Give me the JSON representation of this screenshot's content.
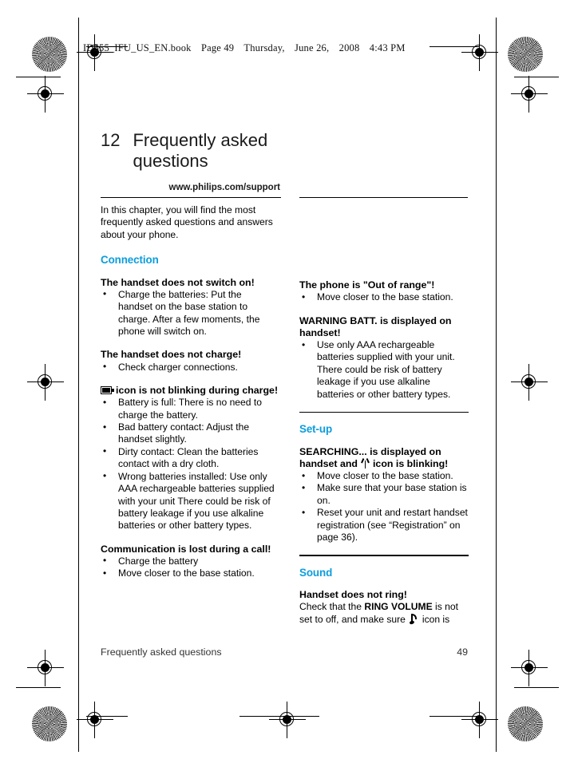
{
  "banner": {
    "filename": "ID555_IFU_US_EN.book",
    "page_label": "Page 49",
    "weekday": "Thursday,",
    "month_day": "June 26,",
    "year": "2008",
    "time": "4:43 PM"
  },
  "chapter": {
    "number": "12",
    "title": "Frequently asked questions",
    "support_url": "www.philips.com/support"
  },
  "intro": "In this chapter, you will find the most frequently asked questions and answers about your phone.",
  "left_column": {
    "section_heading": "Connection",
    "q1": {
      "title": "The handset does not switch on!",
      "bullets": [
        "Charge the batteries: Put the handset on the base station to charge. After a few moments, the phone will switch on."
      ]
    },
    "q2": {
      "title": "The handset does not charge!",
      "bullets": [
        "Check charger connections."
      ]
    },
    "q3": {
      "icon": "battery-icon",
      "title": "icon is not blinking during charge!",
      "bullets": [
        "Battery is full: There is no need to charge the battery.",
        "Bad battery contact: Adjust the handset slightly.",
        "Dirty contact: Clean the batteries contact with a dry cloth.",
        "Wrong batteries installed: Use only AAA rechargeable batteries supplied with your unit There could be risk of battery leakage if you use alkaline batteries or other battery types."
      ]
    },
    "q4": {
      "title": "Communication is lost during a call!",
      "bullets": [
        "Charge the battery",
        "Move closer to the base station."
      ]
    }
  },
  "right_column": {
    "q1": {
      "title": "The phone is \"Out of range\"!",
      "bullets": [
        "Move closer to the base station."
      ]
    },
    "q2": {
      "title": "WARNING BATT. is displayed on handset!",
      "bullets": [
        "Use only AAA rechargeable batteries supplied with your unit. There could be risk of battery leakage if you use alkaline batteries or other battery types."
      ]
    },
    "section_setup_heading": "Set-up",
    "q3": {
      "title_part1": "SEARCHING... is displayed on handset and",
      "icon": "antenna-icon",
      "title_part2": "icon is blinking!",
      "bullets": [
        "Move closer to the base station.",
        "Make sure that your base station is on.",
        "Reset your unit and restart handset registration (see “Registration” on page 36)."
      ]
    },
    "section_sound_heading": "Sound",
    "q4": {
      "title": "Handset does not ring!",
      "body_part1": "Check that the ",
      "body_bold": "RING VOLUME",
      "body_part2": " is not set to off, and make sure",
      "icon": "music-note-icon",
      "body_part3": "icon is"
    }
  },
  "footer": {
    "left": "Frequently asked questions",
    "page_number": "49"
  },
  "colors": {
    "heading_accent": "#0b9ddd",
    "text": "#000000"
  }
}
